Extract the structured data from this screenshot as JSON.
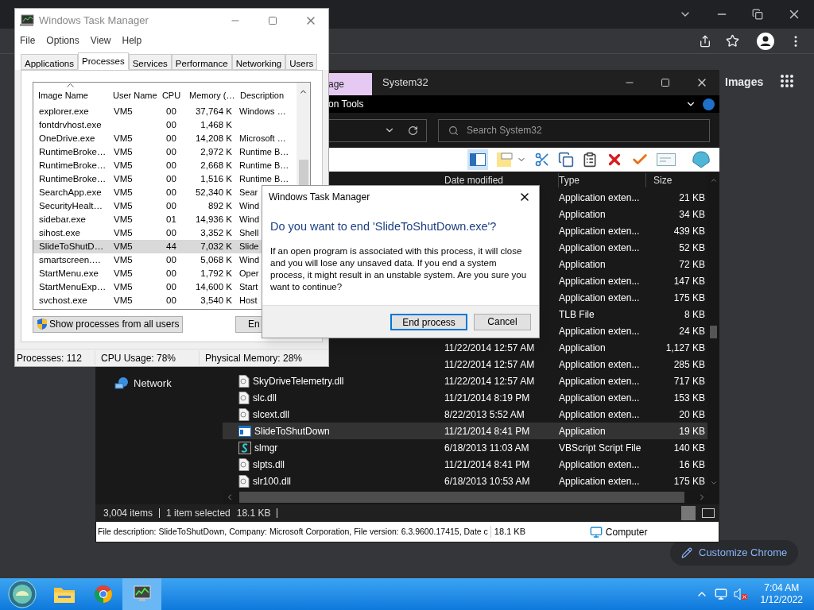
{
  "browser": {
    "link": "Images",
    "customize_button": "Customize Chrome"
  },
  "explorer": {
    "context_tab": "age",
    "title": "System32",
    "ribbon_label": "on Tools",
    "search": {
      "placeholder": "Search System32"
    },
    "toolbar": {
      "pane_toggle_on": true
    },
    "columns": [
      "Date modified",
      "Type",
      "Size"
    ],
    "rows": [
      {
        "type": "Application exten...",
        "size": "21 KB",
        "selected": false
      },
      {
        "type": "Application",
        "size": "34 KB",
        "selected": false
      },
      {
        "type": "Application exten...",
        "size": "439 KB",
        "selected": false
      },
      {
        "type": "Application exten...",
        "size": "52 KB",
        "selected": false
      },
      {
        "type": "Application",
        "size": "72 KB",
        "selected": false
      },
      {
        "type": "Application exten...",
        "size": "147 KB",
        "selected": false
      },
      {
        "type": "Application exten...",
        "size": "175 KB",
        "selected": false
      },
      {
        "type": "TLB File",
        "size": "8 KB",
        "selected": false
      },
      {
        "type": "Application exten...",
        "size": "24 KB",
        "selected": false
      },
      {
        "date": "11/22/2014 12:57 AM",
        "type": "Application",
        "size": "1,127 KB",
        "selected": false
      },
      {
        "date": "11/22/2014 12:57 AM",
        "type": "Application exten...",
        "size": "285 KB",
        "selected": false
      },
      {
        "name": "SkyDriveTelemetry.dll",
        "kind": "dll",
        "date": "11/22/2014 12:57 AM",
        "type": "Application exten...",
        "size": "717 KB",
        "selected": false
      },
      {
        "name": "slc.dll",
        "kind": "dll",
        "date": "11/21/2014 8:19 PM",
        "type": "Application exten...",
        "size": "153 KB",
        "selected": false
      },
      {
        "name": "slcext.dll",
        "kind": "dll",
        "date": "8/22/2013 5:52 AM",
        "type": "Application exten...",
        "size": "20 KB",
        "selected": false
      },
      {
        "name": "SlideToShutDown",
        "kind": "app",
        "date": "11/21/2014 8:41 PM",
        "type": "Application",
        "size": "19 KB",
        "selected": true
      },
      {
        "name": "slmgr",
        "kind": "script",
        "date": "6/18/2013 11:03 AM",
        "type": "VBScript Script File",
        "size": "140 KB",
        "selected": false
      },
      {
        "name": "slpts.dll",
        "kind": "dll",
        "date": "11/21/2014 8:41 PM",
        "type": "Application exten...",
        "size": "16 KB",
        "selected": false
      },
      {
        "name": "slr100.dll",
        "kind": "dll",
        "date": "6/18/2013 10:53 AM",
        "type": "Application exten...",
        "size": "175 KB",
        "selected": false
      }
    ],
    "nav": [
      {
        "label": "Network"
      }
    ],
    "status": [
      "3,004 items",
      "1 item selected",
      "18.1 KB"
    ],
    "details": {
      "description": "File description: SlideToShutDown, Company: Microsoft Corporation, File version: 6.3.9600.17415, Date c",
      "size": "18.1 KB",
      "location": "Computer"
    }
  },
  "task_manager": {
    "title": "Windows Task Manager",
    "menu": [
      "File",
      "Options",
      "View",
      "Help"
    ],
    "tabs": [
      {
        "label": "Applications",
        "selected": false
      },
      {
        "label": "Processes",
        "selected": true
      },
      {
        "label": "Services",
        "selected": false
      },
      {
        "label": "Performance",
        "selected": false
      },
      {
        "label": "Networking",
        "selected": false
      },
      {
        "label": "Users",
        "selected": false
      }
    ],
    "columns": [
      "Image Name",
      "User Name",
      "CPU",
      "Memory (…",
      "Description"
    ],
    "rows": [
      {
        "name": "explorer.exe",
        "user": "VM5",
        "cpu": "00",
        "memory": "37,764 K",
        "description": "Windows …",
        "selected": false
      },
      {
        "name": "fontdrvhost.exe",
        "cpu": "00",
        "memory": "1,468 K",
        "selected": false
      },
      {
        "name": "OneDrive.exe",
        "user": "VM5",
        "cpu": "00",
        "memory": "14,208 K",
        "description": "Microsoft …",
        "selected": false
      },
      {
        "name": "RuntimeBroke…",
        "user": "VM5",
        "cpu": "00",
        "memory": "2,972 K",
        "description": "Runtime B…",
        "selected": false
      },
      {
        "name": "RuntimeBroke…",
        "user": "VM5",
        "cpu": "00",
        "memory": "2,668 K",
        "description": "Runtime B…",
        "selected": false
      },
      {
        "name": "RuntimeBroke…",
        "user": "VM5",
        "cpu": "00",
        "memory": "1,516 K",
        "description": "Runtime B…",
        "selected": false
      },
      {
        "name": "SearchApp.exe",
        "user": "VM5",
        "cpu": "00",
        "memory": "52,340 K",
        "description": "Sear",
        "selected": false
      },
      {
        "name": "SecurityHealt…",
        "user": "VM5",
        "cpu": "00",
        "memory": "892 K",
        "description": "Wind",
        "selected": false
      },
      {
        "name": "sidebar.exe",
        "user": "VM5",
        "cpu": "01",
        "memory": "14,936 K",
        "description": "Wind",
        "selected": false
      },
      {
        "name": "sihost.exe",
        "user": "VM5",
        "cpu": "00",
        "memory": "3,352 K",
        "description": "Shell",
        "selected": false
      },
      {
        "name": "SlideToShutD…",
        "user": "VM5",
        "cpu": "44",
        "memory": "7,032 K",
        "description": "Slide",
        "selected": true
      },
      {
        "name": "smartscreen.…",
        "user": "VM5",
        "cpu": "00",
        "memory": "5,068 K",
        "description": "Wind",
        "selected": false
      },
      {
        "name": "StartMenu.exe",
        "user": "VM5",
        "cpu": "00",
        "memory": "1,792 K",
        "description": "Oper",
        "selected": false
      },
      {
        "name": "StartMenuExp…",
        "user": "VM5",
        "cpu": "00",
        "memory": "14,600 K",
        "description": "Start",
        "selected": false
      },
      {
        "name": "svchost.exe",
        "user": "VM5",
        "cpu": "00",
        "memory": "3,540 K",
        "description": "Host",
        "selected": false
      }
    ],
    "show_all_button": "Show processes from all users",
    "end_button": "En",
    "status": [
      "Processes: 112",
      "CPU Usage: 78%",
      "Physical Memory: 28%"
    ]
  },
  "dialog": {
    "title": "Windows Task Manager",
    "heading": "Do you want to end 'SlideToShutDown.exe'?",
    "body": "If an open program is associated with this process, it will close and you will lose any unsaved data. If you end a system process, it might result in an unstable system. Are you sure you want to continue?",
    "buttons": [
      {
        "label": "End process",
        "default": true
      },
      {
        "label": "Cancel",
        "default": false
      }
    ]
  },
  "taskbar": {
    "apps": [
      {
        "kind": "folder",
        "selected": false
      },
      {
        "kind": "browser",
        "selected": false
      },
      {
        "kind": "taskmgr",
        "selected": true
      }
    ],
    "time": "7:04 AM",
    "date": "1/12/2022"
  }
}
